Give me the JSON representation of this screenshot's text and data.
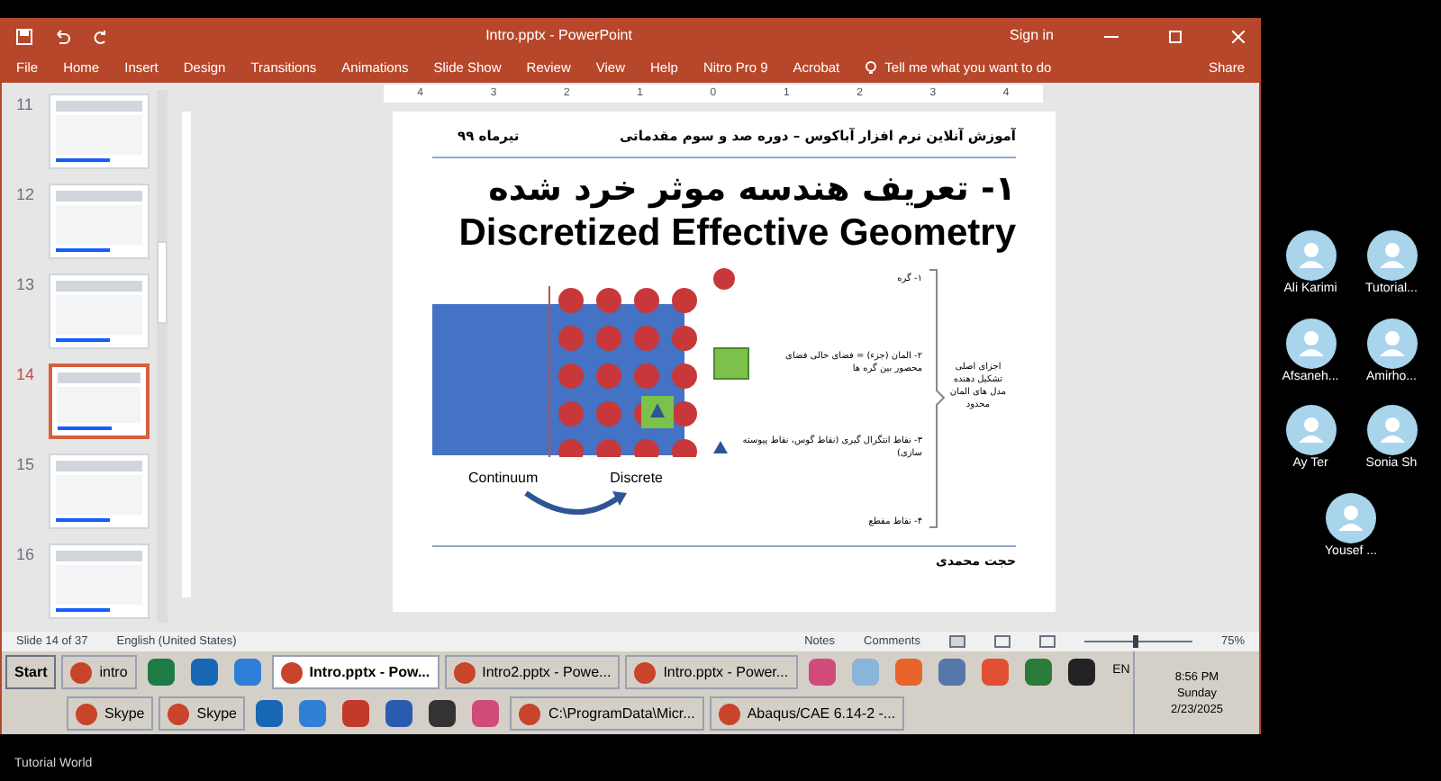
{
  "window": {
    "title": "Intro.pptx - PowerPoint",
    "sign_in": "Sign in"
  },
  "ribbon_tabs": [
    "File",
    "Home",
    "Insert",
    "Design",
    "Transitions",
    "Animations",
    "Slide Show",
    "Review",
    "View",
    "Help",
    "Nitro Pro 9",
    "Acrobat"
  ],
  "tell_me": "Tell me what you want to do",
  "share": "Share",
  "ruler_labels": [
    "4",
    "3",
    "2",
    "1",
    "0",
    "1",
    "2",
    "3",
    "4"
  ],
  "thumbnails": [
    {
      "number": "11",
      "selected": false
    },
    {
      "number": "12",
      "selected": false
    },
    {
      "number": "13",
      "selected": false
    },
    {
      "number": "14",
      "selected": true
    },
    {
      "number": "15",
      "selected": false
    },
    {
      "number": "16",
      "selected": false
    }
  ],
  "slide": {
    "header_right": "آموزش آنلاین نرم افزار آباکوس – دوره صد و سوم مقدماتی",
    "header_left": "تیرماه ۹۹",
    "title_fa": "۱- تعریف هندسه موثر خرد شده",
    "title_en": "Discretized Effective Geometry",
    "continuum": "Continuum",
    "discrete": "Discrete",
    "labels": [
      {
        "kind": "circle",
        "text": "۱- گره"
      },
      {
        "kind": "square",
        "text": "۲- المان (جزء) = فضای خالی فضای محصور بین گره ها"
      },
      {
        "kind": "triangle",
        "text": "۳- نقاط انتگرال گیری (نقاط گوس، نقاط پیوسته سازی)"
      },
      {
        "kind": "none",
        "text": "۴- نقاط مقطع"
      }
    ],
    "group_label": "اجزای اصلی تشکیل دهنده مدل های المان محدود",
    "author": "حجت محمدی"
  },
  "status_bar": {
    "slide": "Slide 14 of 37",
    "language": "English (United States)",
    "notes": "Notes",
    "comments": "Comments",
    "zoom": {
      "level": 0.45
    },
    "zoom_reading": "75%"
  },
  "taskbar": {
    "start": "Start",
    "row1": [
      {
        "kind": "window",
        "label": "intro",
        "selected": false
      },
      {
        "kind": "app"
      },
      {
        "kind": "app"
      },
      {
        "kind": "app"
      },
      {
        "kind": "window",
        "label": "Intro.pptx - Pow...",
        "selected": true
      },
      {
        "kind": "window",
        "label": "Intro2.pptx - Powe...",
        "selected": false
      },
      {
        "kind": "window",
        "label": "Intro.pptx - Power...",
        "selected": false
      },
      {
        "kind": "app"
      },
      {
        "kind": "app"
      },
      {
        "kind": "app"
      },
      {
        "kind": "app"
      },
      {
        "kind": "app"
      },
      {
        "kind": "app"
      },
      {
        "kind": "app"
      }
    ],
    "row2": [
      {
        "kind": "window",
        "label": "Skype",
        "selected": false
      },
      {
        "kind": "window",
        "label": "Skype",
        "selected": false
      },
      {
        "kind": "app"
      },
      {
        "kind": "app"
      },
      {
        "kind": "app"
      },
      {
        "kind": "app"
      },
      {
        "kind": "app"
      },
      {
        "kind": "app"
      },
      {
        "kind": "window",
        "label": "C:\\ProgramData\\Micr...",
        "selected": false
      },
      {
        "kind": "window",
        "label": "Abaqus/CAE 6.14-2 -...",
        "selected": false
      }
    ],
    "language": "EN",
    "time": "8:56 PM",
    "day": "Sunday",
    "date": "2/23/2025"
  },
  "participants": [
    "Ali Karimi",
    "Tutorial...",
    "Afsaneh...",
    "Amirho...",
    "Ay Ter",
    "Sonia Sh",
    "Yousef ..."
  ],
  "footer": "Tutorial World"
}
